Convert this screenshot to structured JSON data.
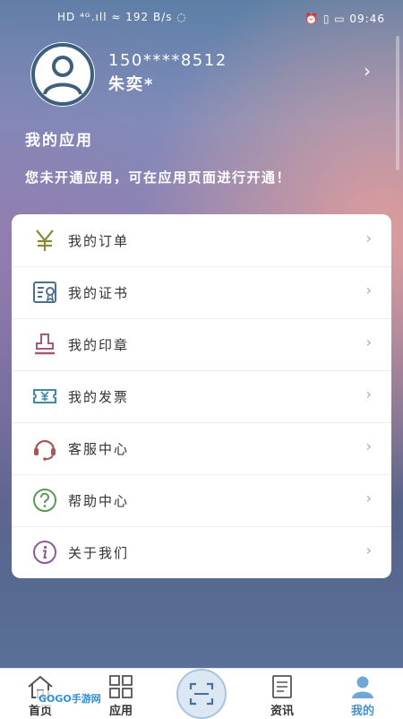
{
  "status_bar": {
    "left": "HD ⁴ᴳ.ıll ≈ 192 B/s ◌",
    "right": "⏰ ▯ ▭ 09:46"
  },
  "profile": {
    "phone": "150****8512",
    "name": "朱奕*"
  },
  "apps": {
    "title": "我的应用",
    "notice": "您未开通应用，可在应用页面进行开通！"
  },
  "menu": [
    {
      "label": "我的订单",
      "icon": "yen-icon"
    },
    {
      "label": "我的证书",
      "icon": "certificate-icon"
    },
    {
      "label": "我的印章",
      "icon": "stamp-icon"
    },
    {
      "label": "我的发票",
      "icon": "invoice-icon"
    },
    {
      "label": "客服中心",
      "icon": "headset-icon"
    },
    {
      "label": "帮助中心",
      "icon": "help-icon"
    },
    {
      "label": "关于我们",
      "icon": "info-icon"
    }
  ],
  "tabs": [
    {
      "label": "首页",
      "icon": "home-icon"
    },
    {
      "label": "应用",
      "icon": "apps-grid-icon"
    },
    {
      "label": "资讯",
      "icon": "news-icon"
    },
    {
      "label": "我的",
      "icon": "user-icon",
      "active": true
    }
  ],
  "watermark": "GOGO手游网",
  "colors": {
    "accent": "#4a90c8",
    "yen": "#8a8a3a",
    "certificate": "#4c6f8f",
    "stamp": "#a35b7a",
    "invoice": "#3d8aa6",
    "headset": "#a85656",
    "help": "#5a9a55",
    "info": "#8a5a9a"
  }
}
